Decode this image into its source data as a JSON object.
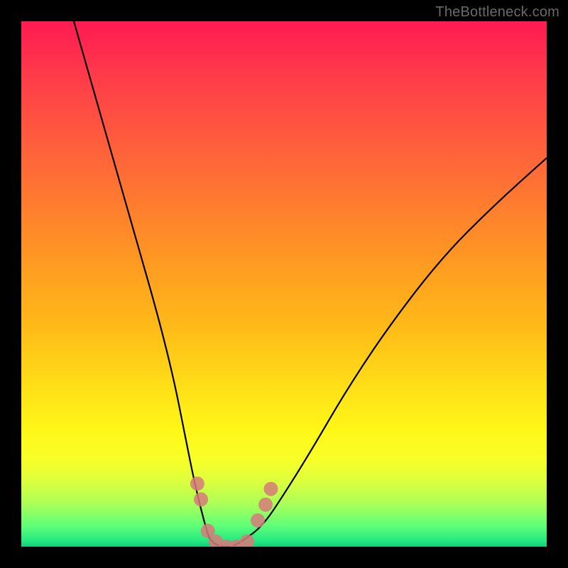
{
  "watermark": "TheBottleneck.com",
  "chart_data": {
    "type": "line",
    "title": "",
    "xlabel": "",
    "ylabel": "",
    "xlim": [
      0,
      100
    ],
    "ylim": [
      0,
      100
    ],
    "grid": false,
    "legend": false,
    "background": "heatmap-gradient red-to-green (top-to-bottom)",
    "series": [
      {
        "name": "curve",
        "color": "#000000",
        "x": [
          10,
          14,
          18,
          22,
          26,
          29,
          31,
          33,
          35,
          36,
          38,
          40,
          42,
          46,
          50,
          55,
          62,
          70,
          80,
          90,
          100
        ],
        "y": [
          100,
          86,
          72,
          58,
          44,
          32,
          22,
          12,
          4,
          1,
          0,
          0,
          1,
          4,
          10,
          18,
          30,
          42,
          55,
          65,
          74
        ]
      }
    ],
    "markers": [
      {
        "name": "marker-left-upper",
        "x": 33.5,
        "y": 12,
        "color": "#d77a7a"
      },
      {
        "name": "marker-left-lower",
        "x": 34.2,
        "y": 9,
        "color": "#d77a7a"
      },
      {
        "name": "marker-trough-1",
        "x": 35.5,
        "y": 3,
        "color": "#d77a7a"
      },
      {
        "name": "marker-trough-2",
        "x": 37.0,
        "y": 1,
        "color": "#d77a7a"
      },
      {
        "name": "marker-trough-3",
        "x": 39.0,
        "y": 0,
        "color": "#d77a7a"
      },
      {
        "name": "marker-trough-4",
        "x": 41.0,
        "y": 0,
        "color": "#d77a7a"
      },
      {
        "name": "marker-trough-5",
        "x": 43.0,
        "y": 1,
        "color": "#d77a7a"
      },
      {
        "name": "marker-right-lower",
        "x": 45.0,
        "y": 5,
        "color": "#d77a7a"
      },
      {
        "name": "marker-right-mid",
        "x": 46.5,
        "y": 8,
        "color": "#d77a7a"
      },
      {
        "name": "marker-right-upper",
        "x": 47.5,
        "y": 11,
        "color": "#d77a7a"
      }
    ]
  }
}
